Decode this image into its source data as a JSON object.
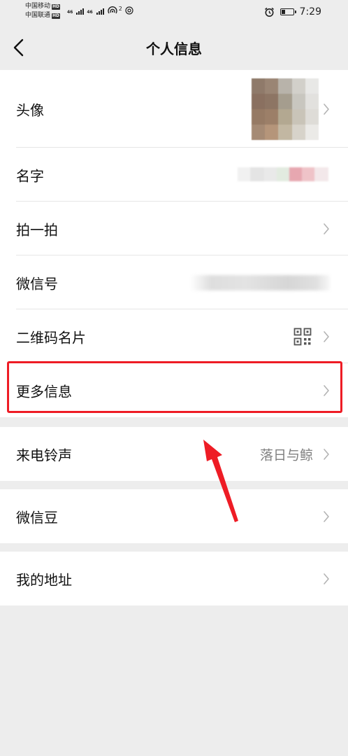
{
  "status_bar": {
    "carrier_1": "中国移动",
    "carrier_2": "中国联通",
    "hd_badge": "HD",
    "network_1": "46",
    "network_2": "46",
    "hotspot_count": "2",
    "time": "7:29"
  },
  "nav": {
    "title": "个人信息",
    "back_icon": "chevron-left-icon"
  },
  "profile_group": [
    {
      "label": "头像",
      "value_type": "avatar"
    },
    {
      "label": "名字",
      "value_type": "blurred-text"
    },
    {
      "label": "拍一拍",
      "value_type": "none"
    },
    {
      "label": "微信号",
      "value_type": "blurred-text"
    },
    {
      "label": "二维码名片",
      "value_type": "qr-icon"
    },
    {
      "label": "更多信息",
      "value_type": "none"
    }
  ],
  "ringtone": {
    "label": "来电铃声",
    "value": "落日与鲸"
  },
  "beans": {
    "label": "微信豆"
  },
  "address": {
    "label": "我的地址"
  },
  "colors": {
    "background": "#ededed",
    "card": "#ffffff",
    "highlight": "#ee1c25",
    "secondary_text": "#808080"
  }
}
